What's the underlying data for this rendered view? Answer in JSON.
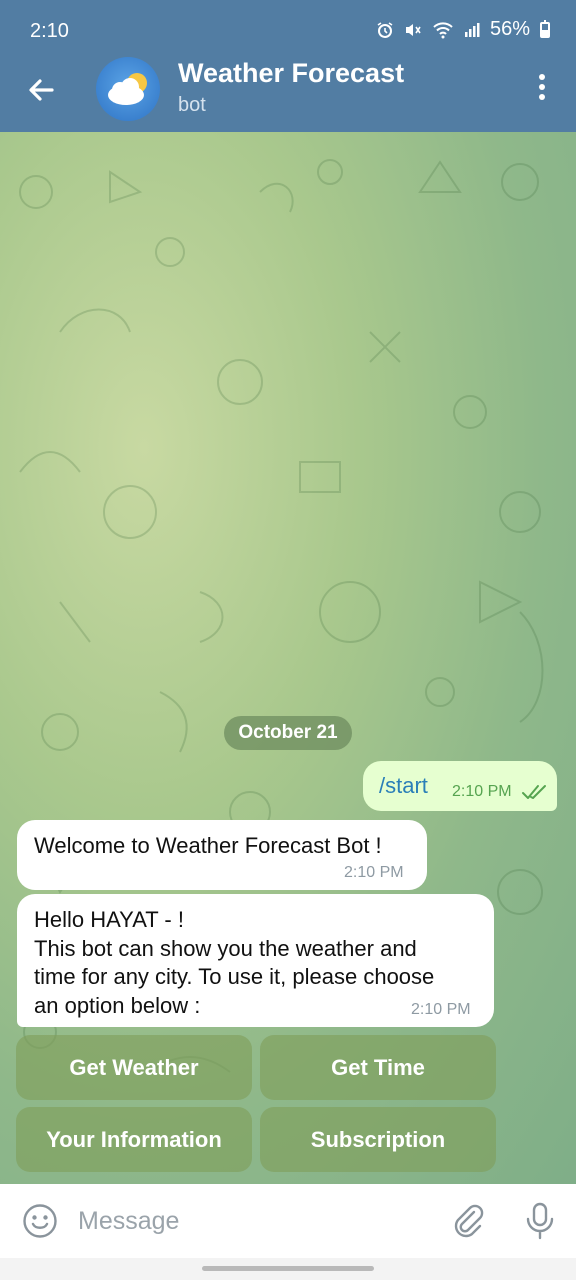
{
  "status_bar": {
    "time": "2:10",
    "battery": "56%"
  },
  "header": {
    "title": "Weather Forecast",
    "subtitle": "bot",
    "avatar_icon": "weather-icon"
  },
  "chat": {
    "date": "October 21",
    "outgoing": [
      {
        "text": "/start",
        "time": "2:10 PM",
        "status": "read"
      }
    ],
    "incoming": [
      {
        "text": "Welcome to Weather Forecast Bot !",
        "time": "2:10 PM"
      },
      {
        "text": "Hello HAYAT - !\nThis bot can show you the weather and\ntime for any city. To use it, please choose\nan option below :",
        "time": "2:10 PM"
      }
    ],
    "keyboard": [
      "Get Weather",
      "Get Time",
      "Your Information",
      "Subscription"
    ]
  },
  "input": {
    "placeholder": "Message"
  },
  "colors": {
    "header": "#527da3",
    "outgoing_bubble": "#e6ffd0",
    "keyboard_button": "#809e5a"
  }
}
